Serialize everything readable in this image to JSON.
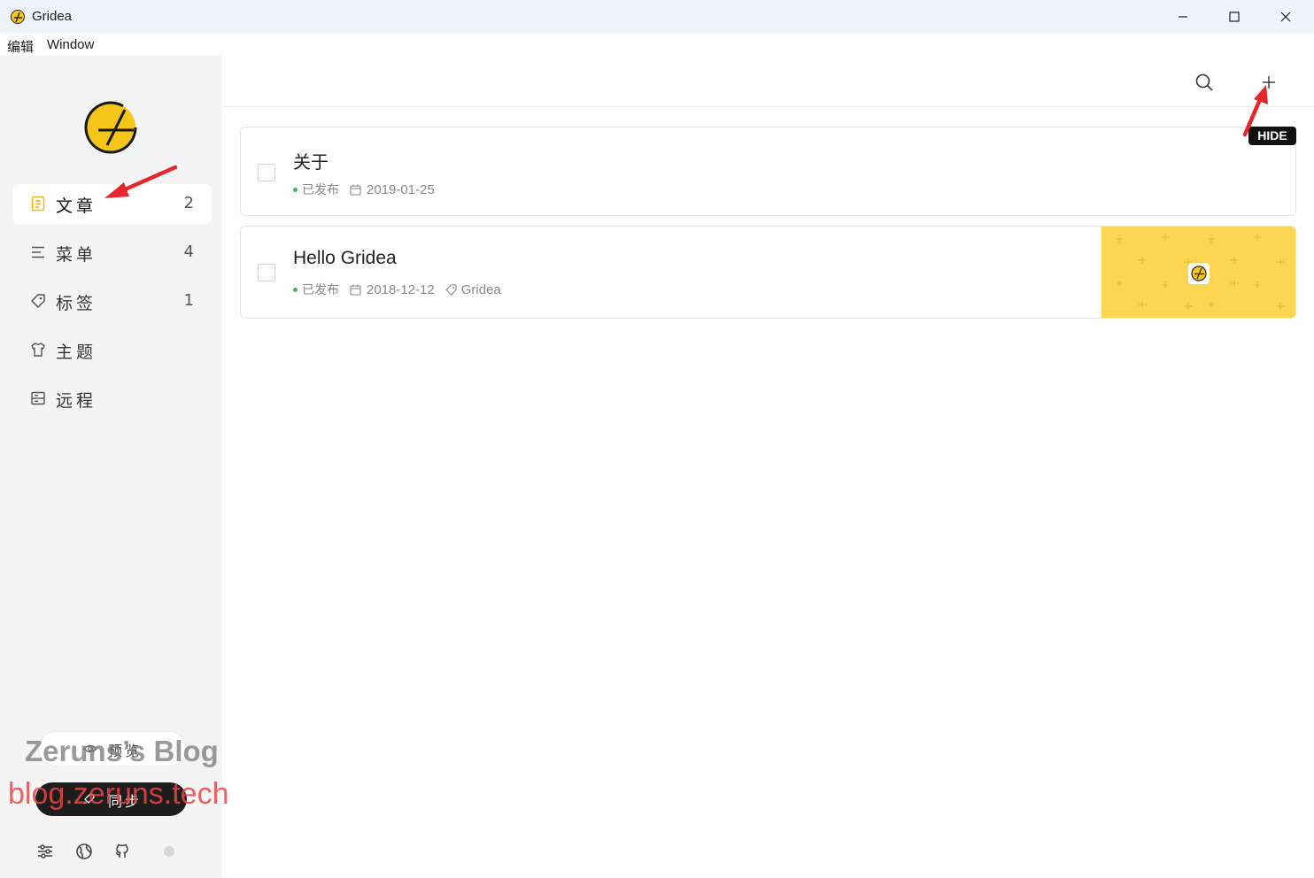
{
  "window": {
    "title": "Gridea",
    "app_icon": "gridea-logo-icon",
    "controls": [
      "minimize-icon",
      "maximize-icon",
      "close-icon"
    ]
  },
  "menubar": {
    "items": [
      "编辑",
      "Window"
    ]
  },
  "sidebar": {
    "logo": "gridea-logo",
    "items": [
      {
        "label": "文章",
        "count": "2",
        "icon": "article-icon",
        "active": true
      },
      {
        "label": "菜单",
        "count": "4",
        "icon": "menu-icon",
        "active": false
      },
      {
        "label": "标签",
        "count": "1",
        "icon": "tag-icon",
        "active": false
      },
      {
        "label": "主题",
        "count": "",
        "icon": "shirt-icon",
        "active": false
      },
      {
        "label": "远程",
        "count": "",
        "icon": "server-icon",
        "active": false
      }
    ],
    "preview_label": "预览",
    "sync_label": "同步",
    "bottom_icons": [
      "settings-sliders-icon",
      "globe-icon",
      "github-icon",
      "status-dot"
    ]
  },
  "watermark": {
    "line1": "Zeruns’s Blog",
    "line2": "blog.zeruns.tech"
  },
  "header": {
    "icons": [
      "search-icon",
      "add-icon"
    ],
    "hide_badge": "HIDE"
  },
  "posts": [
    {
      "title": "关于",
      "status": "已发布",
      "date": "2019-01-25",
      "tags": []
    },
    {
      "title": "Hello Gridea",
      "status": "已发布",
      "date": "2018-12-12",
      "tags": [
        "Gridea"
      ],
      "has_feature_image": true
    }
  ],
  "colors": {
    "accent_yellow": "#f5c518",
    "feature_bg": "#fcd552",
    "published_dot": "#3bb56a",
    "annotation_red": "#e8262a",
    "sidebar_bg": "#f4f4f4",
    "sync_bg": "#1d1d1d"
  }
}
